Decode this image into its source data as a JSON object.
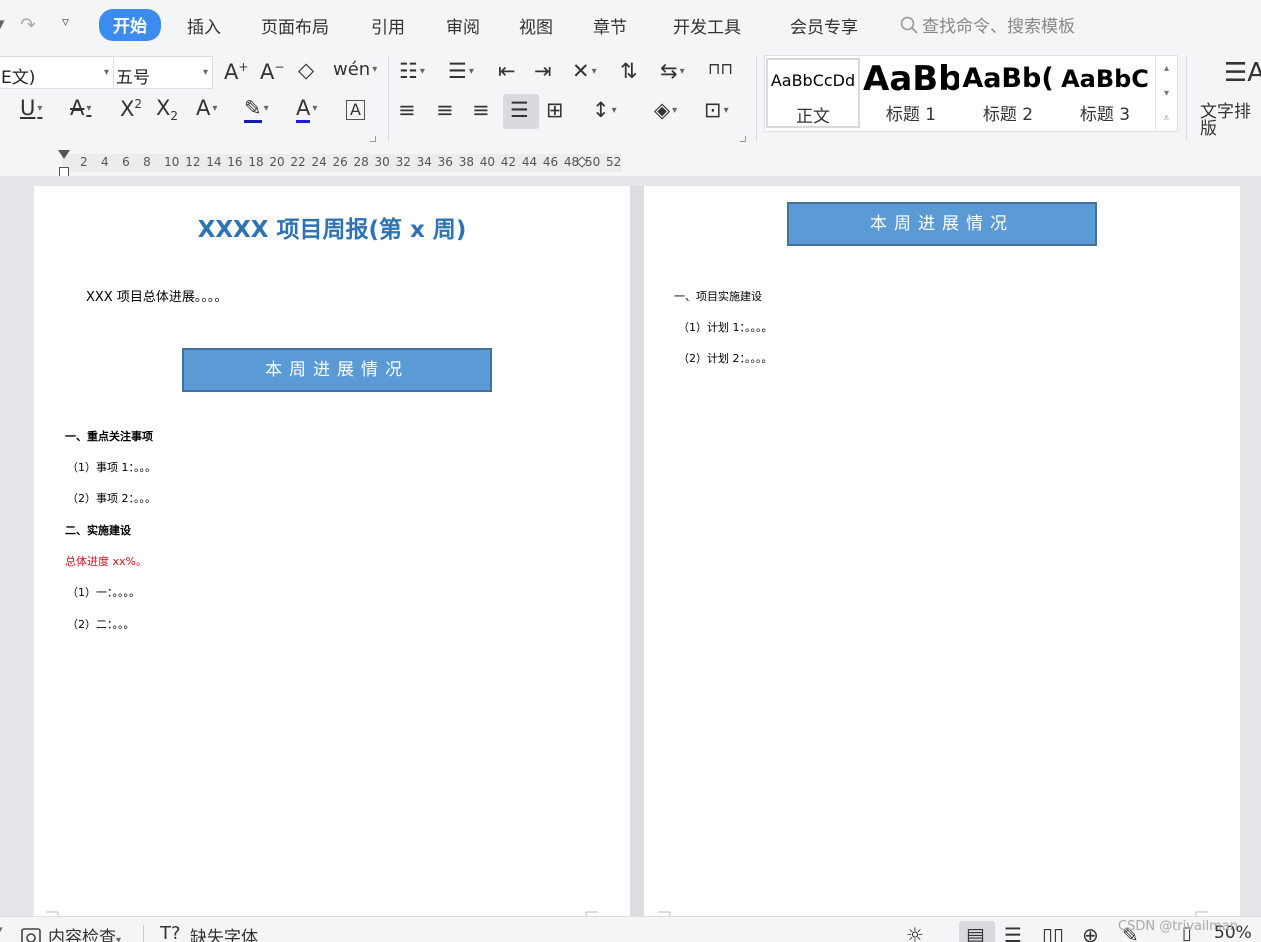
{
  "tabs": {
    "active": "开始",
    "items": [
      "插入",
      "页面布局",
      "引用",
      "审阅",
      "视图",
      "章节",
      "开发工具",
      "会员专享"
    ]
  },
  "search": {
    "placeholder": "查找命令、搜索模板"
  },
  "ribbon": {
    "font_name": "E文)",
    "font_size": "五号",
    "phonetic_label": "wén",
    "style_gallery": [
      {
        "sample": "AaBbCcDd",
        "name": "正文"
      },
      {
        "sample": "AaBb",
        "name": "标题 1"
      },
      {
        "sample": "AaBb(",
        "name": "标题 2"
      },
      {
        "sample": "AaBbC",
        "name": "标题 3"
      }
    ],
    "text_layout_label": "文字排版"
  },
  "ruler": {
    "ticks": [
      "2",
      "4",
      "6",
      "8",
      "10",
      "12",
      "14",
      "16",
      "18",
      "20",
      "22",
      "24",
      "26",
      "28",
      "30",
      "32",
      "34",
      "36",
      "38",
      "40",
      "42",
      "44",
      "46",
      "48",
      "50",
      "52"
    ]
  },
  "document": {
    "page1": {
      "title": "XXXX 项目周报(第 x 周)",
      "intro": "XXX 项目总体进展。。。。",
      "banner": "本周进展情况",
      "section1_heading": "一、重点关注事项",
      "section1_items": [
        "（1）事项 1：。。。",
        "（2）事项 2：。。。"
      ],
      "section2_heading": "二、实施建设",
      "progress_note": "总体进度 xx%。",
      "section2_items": [
        "（1）一：。。。。",
        "（2）二：。。。"
      ]
    },
    "page2": {
      "banner": "本周进展情况",
      "section_heading": "一、项目实施建设",
      "items": [
        "（1）计划 1：。。。。",
        "（2）计划 2：。。。。"
      ]
    }
  },
  "statusbar": {
    "content_check": "内容检查",
    "missing_fonts": "缺失字体",
    "zoom": "50%"
  },
  "watermark": "CSDN @trivailman",
  "colors": {
    "accent_tab": "#3c8cf0",
    "title_blue": "#2e74b5",
    "banner_fill": "#5b9bd5",
    "banner_border": "#41719c",
    "progress_red": "#d0141b"
  }
}
